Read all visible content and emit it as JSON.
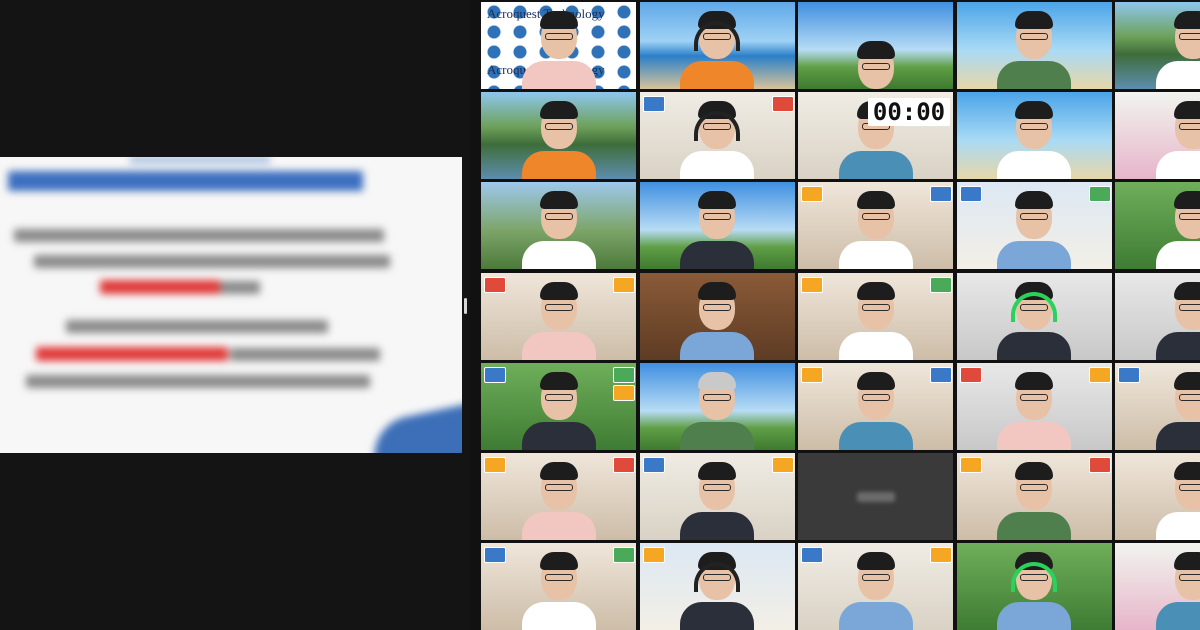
{
  "timer": {
    "text": "00:00"
  },
  "watermark": {
    "text": "Acroquest Technology"
  },
  "colors": {
    "background": "#111111",
    "active_speaker_border": "#31d158",
    "slide_title": "#3e6fc0",
    "slide_highlight": "#e03a3a"
  },
  "gallery": {
    "columns": 5,
    "rows": 7,
    "tiles": [
      {
        "bg": "pattern",
        "body": "pink",
        "watermark": true
      },
      {
        "bg": "ocean",
        "body": "orange",
        "headset": "dark"
      },
      {
        "bg": "sky",
        "body": "white",
        "partial": true
      },
      {
        "bg": "beach",
        "body": "green"
      },
      {
        "bg": "lake",
        "body": "white"
      },
      {
        "bg": "lake",
        "body": "orange"
      },
      {
        "bg": "office",
        "body": "white",
        "headset": "dark",
        "badges": [
          "blue",
          "red"
        ]
      },
      {
        "bg": "office",
        "body": "floral",
        "timer": true
      },
      {
        "bg": "beach",
        "body": "white"
      },
      {
        "bg": "flowers",
        "body": "white"
      },
      {
        "bg": "stadium",
        "body": "white"
      },
      {
        "bg": "sky",
        "body": "dark"
      },
      {
        "bg": "room",
        "body": "white",
        "badges": [
          "orange",
          "blue"
        ]
      },
      {
        "bg": "window",
        "body": "blue",
        "badges": [
          "blue",
          "green"
        ]
      },
      {
        "bg": "forest",
        "body": "grey"
      },
      {
        "bg": "room",
        "body": "pink",
        "badges": [
          "red",
          "orange"
        ]
      },
      {
        "bg": "wood",
        "body": "blue"
      },
      {
        "bg": "room",
        "body": "white",
        "badges": [
          "orange",
          "green"
        ]
      },
      {
        "bg": "grey",
        "body": "dark",
        "headset": "green",
        "active": true
      },
      {
        "bg": "grey",
        "body": "dark"
      },
      {
        "bg": "forest",
        "body": "dark",
        "badges": [
          "blue",
          "green",
          "orange"
        ]
      },
      {
        "bg": "sky",
        "body": "green",
        "hair": "grey"
      },
      {
        "bg": "room",
        "body": "floral",
        "badges": [
          "orange",
          "blue"
        ]
      },
      {
        "bg": "grey",
        "body": "pink",
        "badges": [
          "red",
          "orange"
        ]
      },
      {
        "bg": "room",
        "body": "dark",
        "badges": [
          "blue"
        ]
      },
      {
        "bg": "room",
        "body": "pink",
        "badges": [
          "orange",
          "red"
        ]
      },
      {
        "bg": "office",
        "body": "dark",
        "badges": [
          "blue",
          "orange"
        ]
      },
      {
        "empty": true
      },
      {
        "bg": "room",
        "body": "green",
        "badges": [
          "orange",
          "red"
        ]
      },
      {
        "bg": "room",
        "body": "white"
      },
      {
        "bg": "room",
        "body": "white",
        "badges": [
          "blue",
          "green"
        ]
      },
      {
        "bg": "window",
        "body": "dark",
        "headset": "dark",
        "badges": [
          "orange"
        ]
      },
      {
        "bg": "office",
        "body": "blue",
        "badges": [
          "blue",
          "orange"
        ]
      },
      {
        "bg": "forest",
        "body": "blue",
        "headset": "green"
      },
      {
        "bg": "flowers",
        "body": "floral"
      }
    ]
  }
}
